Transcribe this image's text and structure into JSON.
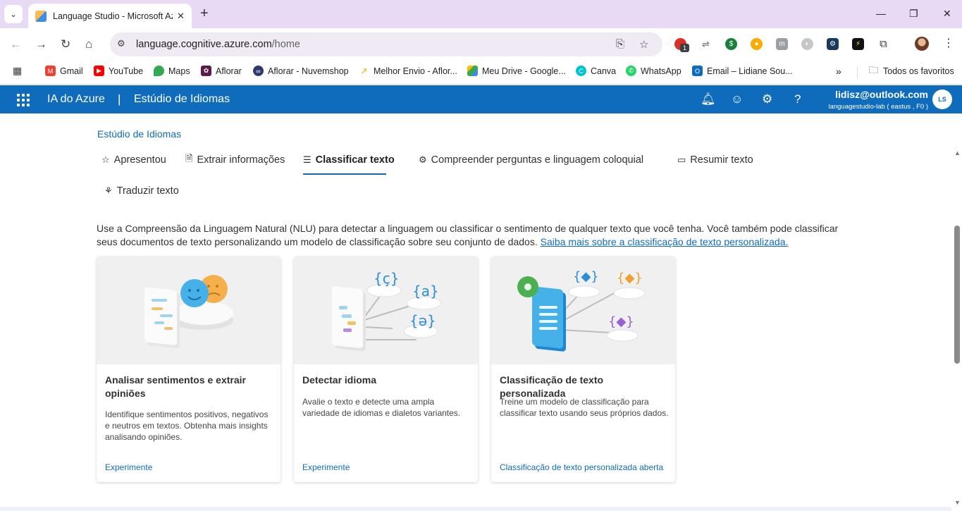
{
  "browser": {
    "tab_title": "Language Studio - Microsoft Az",
    "url_domain": "language.cognitive.azure.com",
    "url_path": "/home",
    "bookmarks": [
      {
        "label": "Gmail",
        "icon": "gmail-icon",
        "color": "#ea4335"
      },
      {
        "label": "YouTube",
        "icon": "youtube-icon",
        "color": "#ff0000"
      },
      {
        "label": "Maps",
        "icon": "maps-icon",
        "color": "#34a853"
      },
      {
        "label": "Aflorar",
        "icon": "aflorar-icon",
        "color": "#5b1a4a"
      },
      {
        "label": "Aflorar - Nuvemshop",
        "icon": "nuvemshop-icon",
        "color": "#2d3a72"
      },
      {
        "label": "Melhor Envio - Aflor...",
        "icon": "melhor-envio-icon",
        "color": "#f4b400"
      },
      {
        "label": "Meu Drive - Google...",
        "icon": "google-drive-icon",
        "color": "#1fa463"
      },
      {
        "label": "Canva",
        "icon": "canva-icon",
        "color": "#00c4cc"
      },
      {
        "label": "WhatsApp",
        "icon": "whatsapp-icon",
        "color": "#25d366"
      },
      {
        "label": "Email – Lidiane Sou...",
        "icon": "outlook-icon",
        "color": "#0f6cbd"
      }
    ],
    "all_bookmarks": "Todos os favoritos",
    "extension_badge": "1"
  },
  "azure": {
    "brand": "IA do Azure",
    "separator": "|",
    "product": "Estúdio de Idiomas",
    "account_email": "lidisz@outlook.com",
    "account_sub": "languagestudio-lab ( eastus , F0 )",
    "avatar_initials": "LS"
  },
  "page": {
    "breadcrumb": "Estúdio de Idiomas",
    "tabs": [
      {
        "label": "Apresentou",
        "icon": "star-icon"
      },
      {
        "label": "Extrair informações",
        "icon": "document-icon"
      },
      {
        "label": "Classificar texto",
        "icon": "list-icon",
        "active": true
      },
      {
        "label": "Compreender perguntas e linguagem coloquial",
        "icon": "bot-icon"
      },
      {
        "label": "Resumir texto",
        "icon": "summary-icon"
      },
      {
        "label": "Traduzir texto",
        "icon": "translate-icon"
      }
    ],
    "description": "Use a Compreensão da Linguagem Natural (NLU) para detectar a linguagem ou classificar o sentimento de qualquer texto que você tenha. Você também pode classificar seus documentos de texto personalizando um modelo de classificação sobre seu conjunto de dados.",
    "description_link": "Saiba mais sobre a classificação de texto personalizada.",
    "cards": [
      {
        "title": "Analisar sentimentos e extrair opiniões",
        "text": "Identifique sentimentos positivos, negativos e neutros em textos. Obtenha mais insights analisando opiniões.",
        "link": "Experimente"
      },
      {
        "title": "Detectar idioma",
        "text": "Avalie o texto e detecte uma ampla variedade de idiomas e dialetos variantes.",
        "link": "Experimente"
      },
      {
        "title": "Classificação de texto personalizada",
        "text": "Treine um modelo de classificação para classificar texto usando seus próprios dados.",
        "link": "Classificação de texto personalizada aberta"
      }
    ]
  },
  "colors": {
    "azure_blue": "#0f6cbd",
    "tabstrip": "#e8d9f5",
    "card_image_bg": "#f0f0f0"
  }
}
